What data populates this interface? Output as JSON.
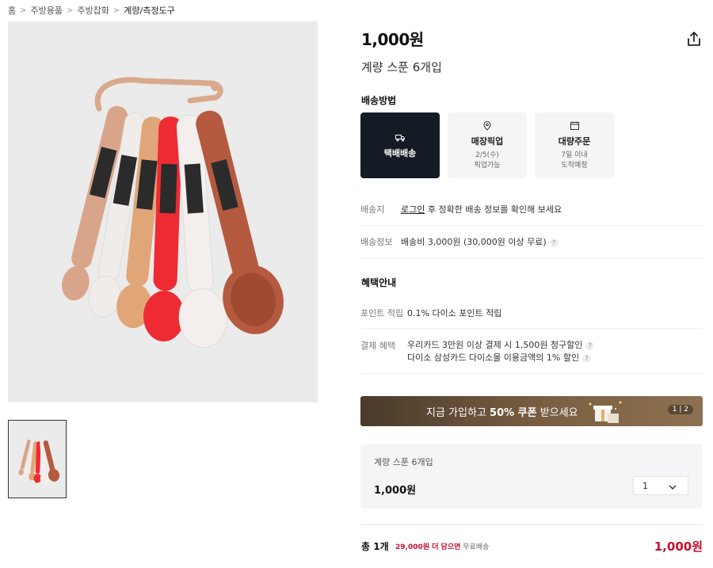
{
  "breadcrumb": [
    "홈",
    "주방용품",
    "주방잡화",
    "계량/측정도구"
  ],
  "product": {
    "price": "1,000원",
    "title": "계량 스푼 6개입"
  },
  "shipping": {
    "heading": "배송방법",
    "options": [
      {
        "label": "택배배송",
        "sub1": "",
        "sub2": "",
        "icon": "truck-icon",
        "active": true
      },
      {
        "label": "매장픽업",
        "sub1": "2/5(수)",
        "sub2": "픽업가능",
        "icon": "map-pin-icon",
        "active": false
      },
      {
        "label": "대량주문",
        "sub1": "7일 이내",
        "sub2": "도착예정",
        "icon": "calendar-icon",
        "active": false
      }
    ],
    "dest_label": "배송지",
    "dest_link": "로그인",
    "dest_text": " 후 정확한 배송 정보를 확인해 보세요",
    "info_label": "배송정보",
    "info_text": "배송비 3,000원 (30,000원 이상 무료)",
    "help_mark": "?"
  },
  "benefits": {
    "heading": "혜택안내",
    "point_label": "포인트 적립",
    "point_text": "0.1% 다이소 포인트 적립",
    "pay_label": "결제 혜택",
    "pay_lines": [
      "우리카드 3만원 이상 결제 시 1,500원 청구할인",
      "다이소 삼성카드 다이소몰 이용금액의 1% 할인"
    ]
  },
  "banner": {
    "text_pre": "지금 가입하고 ",
    "text_bold": "50% 쿠폰",
    "text_post": " 받으세요",
    "pager": "1 | 2"
  },
  "option": {
    "name": "계량 스푼 6개입",
    "price": "1,000원",
    "qty": "1"
  },
  "total": {
    "label": "총 1개",
    "more_amount": "29,000원 더 담으면",
    "free_text": " 무료배송",
    "price": "1,000원"
  },
  "colors": {
    "accent": "#c8102e",
    "active_bg": "#151b24",
    "panel_bg": "#f4f5f7",
    "spoons": [
      "#d9a58a",
      "#ece8e6",
      "#e1a677",
      "#ee2b33",
      "#f4efec",
      "#b55a3f"
    ]
  }
}
